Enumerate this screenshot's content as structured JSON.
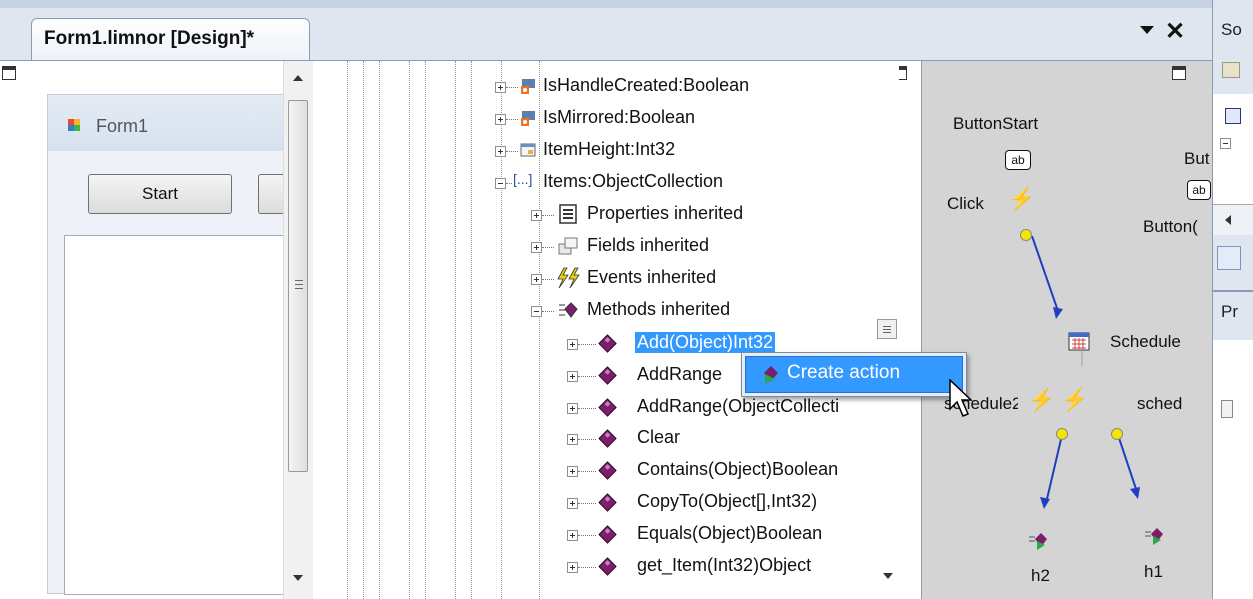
{
  "document_tab": {
    "title": "Form1.limnor [Design]*"
  },
  "designer": {
    "form_title": "Form1",
    "start_button_label": "Start"
  },
  "tree": {
    "rows": [
      {
        "label": "IsHandleCreated:Boolean",
        "icon": "property-locked-icon"
      },
      {
        "label": "IsMirrored:Boolean",
        "icon": "property-locked-icon"
      },
      {
        "label": "ItemHeight:Int32",
        "icon": "property-icon"
      },
      {
        "label": "Items:ObjectCollection",
        "icon": "collection-icon"
      },
      {
        "label": "Properties inherited",
        "icon": "properties-list-icon"
      },
      {
        "label": "Fields inherited",
        "icon": "fields-icon"
      },
      {
        "label": "Events inherited",
        "icon": "events-lightning-icon"
      },
      {
        "label": "Methods inherited",
        "icon": "methods-icon"
      },
      {
        "label": "Add(Object)Int32",
        "icon": "method-gem-icon"
      },
      {
        "label": "AddRange",
        "icon": "method-gem-icon"
      },
      {
        "label": "AddRange(ObjectCollecti",
        "icon": "method-gem-icon"
      },
      {
        "label": "Clear",
        "icon": "method-gem-icon"
      },
      {
        "label": "Contains(Object)Boolean",
        "icon": "method-gem-icon"
      },
      {
        "label": "CopyTo(Object[],Int32)",
        "icon": "method-gem-icon"
      },
      {
        "label": "Equals(Object)Boolean",
        "icon": "method-gem-icon"
      },
      {
        "label": "get_Item(Int32)Object",
        "icon": "method-gem-icon"
      }
    ]
  },
  "context_menu": {
    "items": [
      {
        "label": "Create action",
        "icon": "create-action-icon"
      }
    ]
  },
  "diagram": {
    "button_start": "ButtonStart",
    "button_partial": "But",
    "button2_partial": "Button(",
    "click_event": "Click",
    "schedule_label": "Schedule",
    "schedule2_label": "schedule2",
    "sched_label": "sched",
    "h2_label": "h2",
    "h1_label": "h1"
  },
  "side_panel": {
    "top_label": "So",
    "mid_label": "Pr"
  },
  "colors": {
    "selection": "#3399ff",
    "diagram_bg": "#d4d4d4",
    "arrow": "#1f3fbf",
    "connector": "#f5e600"
  }
}
